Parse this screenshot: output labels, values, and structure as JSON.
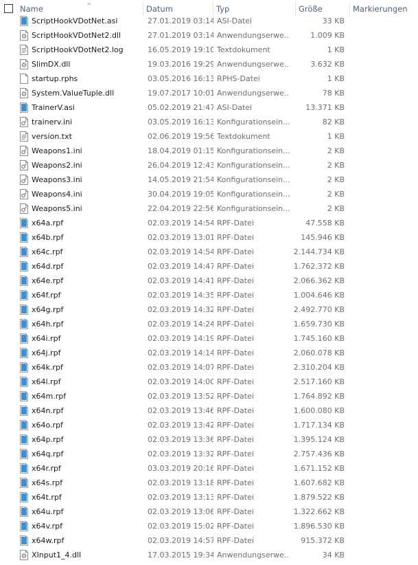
{
  "columns": {
    "name": "Name",
    "date": "Datum",
    "type": "Typ",
    "size": "Größe",
    "tags": "Markierungen"
  },
  "files": [
    {
      "name": "ScriptHookVDotNet.asi",
      "date": "27.01.2019 03:14",
      "type": "ASI-Datei",
      "size": "33 KB",
      "icon": "blue-file-icon"
    },
    {
      "name": "ScriptHookVDotNet2.dll",
      "date": "27.01.2019 03:14",
      "type": "Anwendungserwe...",
      "size": "1.009 KB",
      "icon": "gear-file-icon"
    },
    {
      "name": "ScriptHookVDotNet2.log",
      "date": "16.05.2019 19:10",
      "type": "Textdokument",
      "size": "1 KB",
      "icon": "text-file-icon"
    },
    {
      "name": "SlimDX.dll",
      "date": "19.03.2016 19:29",
      "type": "Anwendungserwe...",
      "size": "3.632 KB",
      "icon": "gear-file-icon"
    },
    {
      "name": "startup.rphs",
      "date": "03.05.2016 16:13",
      "type": "RPHS-Datei",
      "size": "1 KB",
      "icon": "blank-file-icon"
    },
    {
      "name": "System.ValueTuple.dll",
      "date": "19.07.2017 10:01",
      "type": "Anwendungserwe...",
      "size": "78 KB",
      "icon": "gear-file-icon"
    },
    {
      "name": "TrainerV.asi",
      "date": "05.02.2019 21:47",
      "type": "ASI-Datei",
      "size": "13.371 KB",
      "icon": "blue-file-icon"
    },
    {
      "name": "trainerv.ini",
      "date": "03.05.2019 16:13",
      "type": "Konfigurationsein...",
      "size": "82 KB",
      "icon": "config-file-icon"
    },
    {
      "name": "version.txt",
      "date": "02.06.2019 19:56",
      "type": "Textdokument",
      "size": "1 KB",
      "icon": "text-file-icon"
    },
    {
      "name": "Weapons1.ini",
      "date": "18.04.2019 01:15",
      "type": "Konfigurationsein...",
      "size": "2 KB",
      "icon": "config-file-icon"
    },
    {
      "name": "Weapons2.ini",
      "date": "26.04.2019 12:43",
      "type": "Konfigurationsein...",
      "size": "2 KB",
      "icon": "config-file-icon"
    },
    {
      "name": "Weapons3.ini",
      "date": "14.05.2019 21:54",
      "type": "Konfigurationsein...",
      "size": "2 KB",
      "icon": "config-file-icon"
    },
    {
      "name": "Weapons4.ini",
      "date": "30.04.2019 19:05",
      "type": "Konfigurationsein...",
      "size": "2 KB",
      "icon": "config-file-icon"
    },
    {
      "name": "Weapons5.ini",
      "date": "22.04.2019 22:56",
      "type": "Konfigurationsein...",
      "size": "2 KB",
      "icon": "config-file-icon"
    },
    {
      "name": "x64a.rpf",
      "date": "02.03.2019 14:54",
      "type": "RPF-Datei",
      "size": "47.558 KB",
      "icon": "blue-file-icon"
    },
    {
      "name": "x64b.rpf",
      "date": "02.03.2019 13:01",
      "type": "RPF-Datei",
      "size": "145.946 KB",
      "icon": "blue-file-icon"
    },
    {
      "name": "x64c.rpf",
      "date": "02.03.2019 14:54",
      "type": "RPF-Datei",
      "size": "2.144.734 KB",
      "icon": "blue-file-icon"
    },
    {
      "name": "x64d.rpf",
      "date": "02.03.2019 14:47",
      "type": "RPF-Datei",
      "size": "1.762.372 KB",
      "icon": "blue-file-icon"
    },
    {
      "name": "x64e.rpf",
      "date": "02.03.2019 14:41",
      "type": "RPF-Datei",
      "size": "2.066.362 KB",
      "icon": "blue-file-icon"
    },
    {
      "name": "x64f.rpf",
      "date": "02.03.2019 14:35",
      "type": "RPF-Datei",
      "size": "1.004.646 KB",
      "icon": "blue-file-icon"
    },
    {
      "name": "x64g.rpf",
      "date": "02.03.2019 14:32",
      "type": "RPF-Datei",
      "size": "2.492.770 KB",
      "icon": "blue-file-icon"
    },
    {
      "name": "x64h.rpf",
      "date": "02.03.2019 14:24",
      "type": "RPF-Datei",
      "size": "1.659.730 KB",
      "icon": "blue-file-icon"
    },
    {
      "name": "x64i.rpf",
      "date": "02.03.2019 14:19",
      "type": "RPF-Datei",
      "size": "1.745.160 KB",
      "icon": "blue-file-icon"
    },
    {
      "name": "x64j.rpf",
      "date": "02.03.2019 14:14",
      "type": "RPF-Datei",
      "size": "2.060.078 KB",
      "icon": "blue-file-icon"
    },
    {
      "name": "x64k.rpf",
      "date": "02.03.2019 14:07",
      "type": "RPF-Datei",
      "size": "2.310.204 KB",
      "icon": "blue-file-icon"
    },
    {
      "name": "x64l.rpf",
      "date": "02.03.2019 14:00",
      "type": "RPF-Datei",
      "size": "2.517.160 KB",
      "icon": "blue-file-icon"
    },
    {
      "name": "x64m.rpf",
      "date": "02.03.2019 13:52",
      "type": "RPF-Datei",
      "size": "1.764.892 KB",
      "icon": "blue-file-icon"
    },
    {
      "name": "x64n.rpf",
      "date": "02.03.2019 13:46",
      "type": "RPF-Datei",
      "size": "1.600.080 KB",
      "icon": "blue-file-icon"
    },
    {
      "name": "x64o.rpf",
      "date": "02.03.2019 13:42",
      "type": "RPF-Datei",
      "size": "1.717.134 KB",
      "icon": "blue-file-icon"
    },
    {
      "name": "x64p.rpf",
      "date": "02.03.2019 13:36",
      "type": "RPF-Datei",
      "size": "1.395.124 KB",
      "icon": "blue-file-icon"
    },
    {
      "name": "x64q.rpf",
      "date": "02.03.2019 13:32",
      "type": "RPF-Datei",
      "size": "2.757.436 KB",
      "icon": "blue-file-icon"
    },
    {
      "name": "x64r.rpf",
      "date": "03.03.2019 20:16",
      "type": "RPF-Datei",
      "size": "1.671.152 KB",
      "icon": "blue-file-icon"
    },
    {
      "name": "x64s.rpf",
      "date": "02.03.2019 13:18",
      "type": "RPF-Datei",
      "size": "1.607.682 KB",
      "icon": "blue-file-icon"
    },
    {
      "name": "x64t.rpf",
      "date": "02.03.2019 13:13",
      "type": "RPF-Datei",
      "size": "1.879.522 KB",
      "icon": "blue-file-icon"
    },
    {
      "name": "x64u.rpf",
      "date": "02.03.2019 13:06",
      "type": "RPF-Datei",
      "size": "1.322.662 KB",
      "icon": "blue-file-icon"
    },
    {
      "name": "x64v.rpf",
      "date": "02.03.2019 15:02",
      "type": "RPF-Datei",
      "size": "1.896.530 KB",
      "icon": "blue-file-icon"
    },
    {
      "name": "x64w.rpf",
      "date": "02.03.2019 14:57",
      "type": "RPF-Datei",
      "size": "915.372 KB",
      "icon": "blue-file-icon"
    },
    {
      "name": "XInput1_4.dll",
      "date": "17.03.2015 19:34",
      "type": "Anwendungserwe...",
      "size": "34 KB",
      "icon": "gear-file-icon"
    }
  ]
}
